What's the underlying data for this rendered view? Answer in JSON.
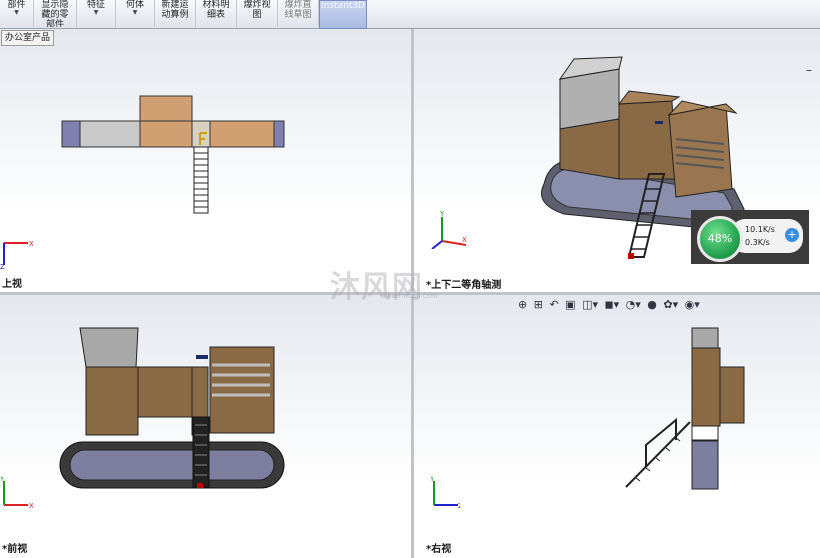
{
  "toolbar": {
    "buttons": [
      {
        "label": "部件",
        "dropdown": true
      },
      {
        "label": "显示隐\n藏的零\n部件",
        "dropdown": false
      },
      {
        "label": "特征",
        "dropdown": true
      },
      {
        "label": "何体",
        "dropdown": true
      },
      {
        "label": "新建运\n动算例",
        "dropdown": false
      },
      {
        "label": "材料明\n细表",
        "dropdown": false
      },
      {
        "label": "爆炸视\n图",
        "dropdown": false
      },
      {
        "label": "爆炸直\n线草图",
        "dropdown": false
      },
      {
        "label": "Instant3D",
        "dropdown": false
      }
    ]
  },
  "tree_tab": "办公室产品",
  "viewports": {
    "top_left": "上视",
    "top_right": "*上下二等角轴测",
    "bottom_left": "*前视",
    "bottom_right": "*右视"
  },
  "hud": {
    "percent": "48%",
    "upload": "10.1K/s",
    "download": "0.3K/s"
  },
  "watermark": {
    "text": "沐风网",
    "sub": "www.mfcad.com"
  },
  "colors": {
    "wood": "#8a6a45",
    "track": "#3a3a3a",
    "panel": "#bcbcbc"
  }
}
